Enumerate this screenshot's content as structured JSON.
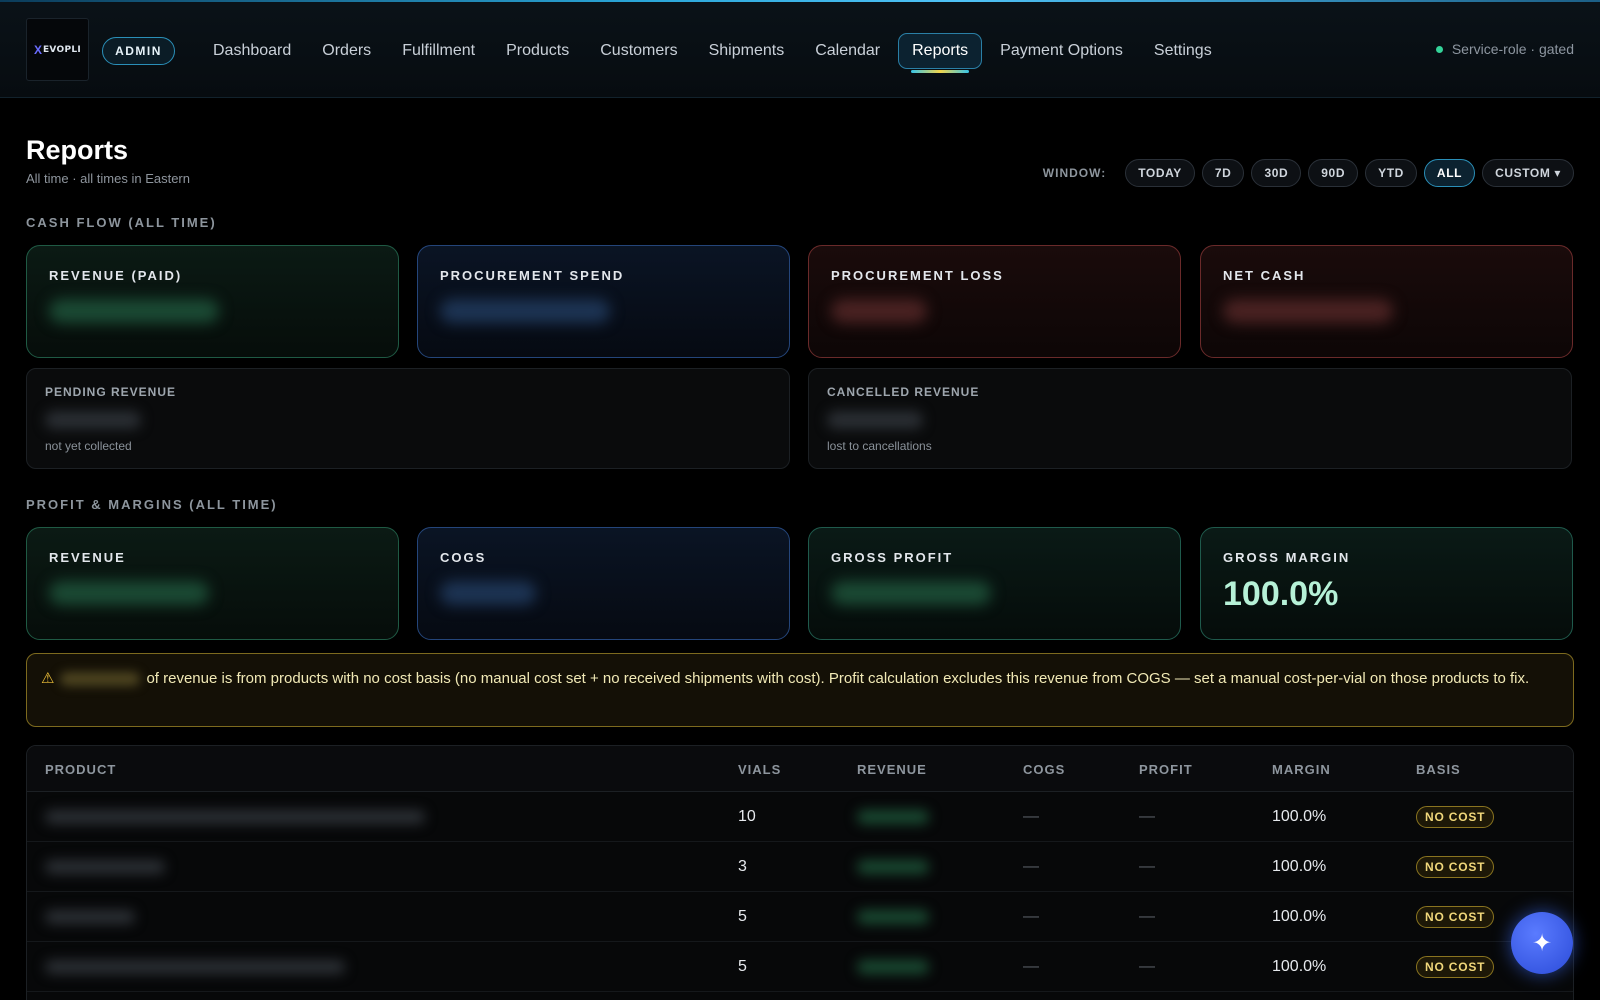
{
  "brand": {
    "logo_x": "X",
    "logo_text": "EVOPLI",
    "admin_label": "ADMIN"
  },
  "nav": {
    "items": [
      {
        "label": "Dashboard",
        "active": false
      },
      {
        "label": "Orders",
        "active": false
      },
      {
        "label": "Fulfillment",
        "active": false
      },
      {
        "label": "Products",
        "active": false
      },
      {
        "label": "Customers",
        "active": false
      },
      {
        "label": "Shipments",
        "active": false
      },
      {
        "label": "Calendar",
        "active": false
      },
      {
        "label": "Reports",
        "active": true
      },
      {
        "label": "Payment Options",
        "active": false
      },
      {
        "label": "Settings",
        "active": false
      }
    ],
    "status_text": "Service-role · gated"
  },
  "page": {
    "title": "Reports",
    "subtitle": "All time · all times in Eastern"
  },
  "window": {
    "label": "WINDOW:",
    "options": [
      {
        "label": "TODAY",
        "active": false
      },
      {
        "label": "7D",
        "active": false
      },
      {
        "label": "30D",
        "active": false
      },
      {
        "label": "90D",
        "active": false
      },
      {
        "label": "YTD",
        "active": false
      },
      {
        "label": "ALL",
        "active": true
      },
      {
        "label": "CUSTOM ▾",
        "active": false
      }
    ]
  },
  "cash_flow": {
    "section_label": "CASH FLOW (ALL TIME)",
    "cards": [
      {
        "title": "REVENUE (PAID)"
      },
      {
        "title": "PROCUREMENT SPEND"
      },
      {
        "title": "PROCUREMENT LOSS"
      },
      {
        "title": "NET CASH"
      }
    ],
    "pending": {
      "title": "PENDING REVENUE",
      "note": "not yet collected"
    },
    "cancelled": {
      "title": "CANCELLED REVENUE",
      "note": "lost to cancellations"
    }
  },
  "profit": {
    "section_label": "PROFIT & MARGINS (ALL TIME)",
    "cards": [
      {
        "title": "REVENUE"
      },
      {
        "title": "COGS"
      },
      {
        "title": "GROSS PROFIT"
      },
      {
        "title": "GROSS MARGIN",
        "value": "100.0%"
      }
    ]
  },
  "warning": {
    "icon": "warning-icon",
    "text_a": "of revenue is from products with no cost basis (no manual cost set + no received shipments with cost). Profit calculation excludes this revenue from COGS — set a manual cost-per-vial on those products to fix."
  },
  "table": {
    "columns": [
      "PRODUCT",
      "VIALS",
      "REVENUE",
      "COGS",
      "PROFIT",
      "MARGIN",
      "BASIS"
    ],
    "rows": [
      {
        "vials": "10",
        "cogs": "—",
        "profit": "—",
        "margin": "100.0%",
        "basis": "NO COST"
      },
      {
        "vials": "3",
        "cogs": "—",
        "profit": "—",
        "margin": "100.0%",
        "basis": "NO COST"
      },
      {
        "vials": "5",
        "cogs": "—",
        "profit": "—",
        "margin": "100.0%",
        "basis": "NO COST"
      },
      {
        "vials": "5",
        "cogs": "—",
        "profit": "—",
        "margin": "100.0%",
        "basis": "NO COST"
      }
    ]
  },
  "fab": {
    "icon": "sparkle-icon",
    "glyph": "✦"
  }
}
